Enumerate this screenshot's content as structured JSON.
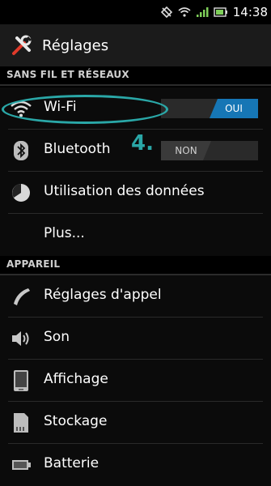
{
  "status": {
    "time": "14:38"
  },
  "app": {
    "title": "Réglages"
  },
  "sections": {
    "wireless": "SANS FIL ET RÉSEAUX",
    "device": "APPAREIL"
  },
  "items": {
    "wifi": {
      "label": "Wi-Fi",
      "toggle": "OUI"
    },
    "bluetooth": {
      "label": "Bluetooth",
      "toggle": "NON"
    },
    "data_usage": {
      "label": "Utilisation des données"
    },
    "more": {
      "label": "Plus..."
    },
    "call_settings": {
      "label": "Réglages d'appel"
    },
    "sound": {
      "label": "Son"
    },
    "display": {
      "label": "Affichage"
    },
    "storage": {
      "label": "Stockage"
    },
    "battery": {
      "label": "Batterie"
    }
  },
  "annotation": {
    "step": "4."
  },
  "colors": {
    "accent": "#1676b5",
    "annotation": "#2aa7a7"
  }
}
